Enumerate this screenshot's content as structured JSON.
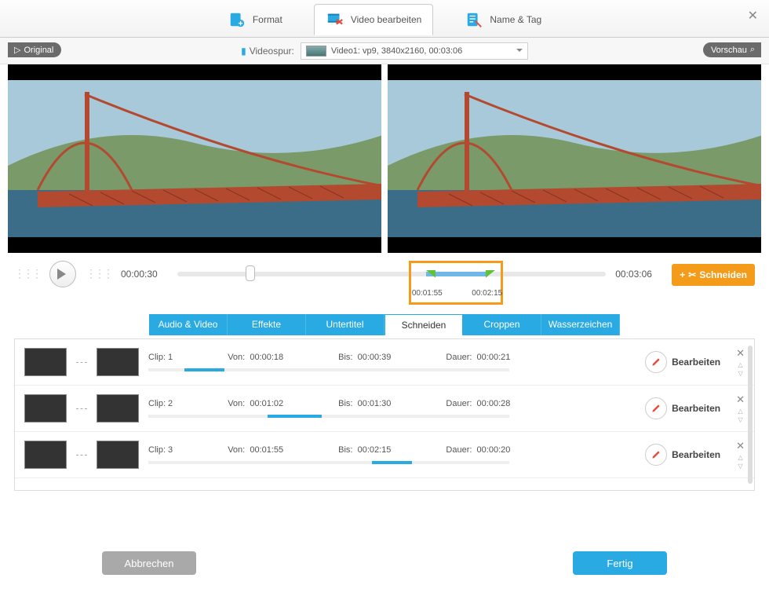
{
  "header": {
    "tabs": [
      {
        "label": "Format",
        "icon": "format"
      },
      {
        "label": "Video bearbeiten",
        "icon": "edit-video",
        "active": true
      },
      {
        "label": "Name & Tag",
        "icon": "tag"
      }
    ]
  },
  "trackbar": {
    "label": "Videospur:",
    "selected": "Video1: vp9, 3840x2160, 00:03:06",
    "original_label": "Original",
    "preview_label": "Vorschau"
  },
  "timeline": {
    "current": "00:00:30",
    "duration": "00:03:06",
    "sel_start": "00:01:55",
    "sel_end": "00:02:15",
    "playhead_pct": 16,
    "sel_start_pct": 58,
    "sel_end_pct": 72,
    "cut_label": "Schneiden"
  },
  "subtabs": [
    "Audio & Video",
    "Effekte",
    "Untertitel",
    "Schneiden",
    "Croppen",
    "Wasserzeichen"
  ],
  "subtab_active": 3,
  "clip_labels": {
    "clip": "Clip:",
    "von": "Von:",
    "bis": "Bis:",
    "dauer": "Dauer:",
    "edit": "Bearbeiten"
  },
  "clips": [
    {
      "n": "1",
      "von": "00:00:18",
      "bis": "00:00:39",
      "dauer": "00:00:21",
      "seg_l": 10,
      "seg_w": 11
    },
    {
      "n": "2",
      "von": "00:01:02",
      "bis": "00:01:30",
      "dauer": "00:00:28",
      "seg_l": 33,
      "seg_w": 15
    },
    {
      "n": "3",
      "von": "00:01:55",
      "bis": "00:02:15",
      "dauer": "00:00:20",
      "seg_l": 62,
      "seg_w": 11
    }
  ],
  "footer": {
    "cancel": "Abbrechen",
    "done": "Fertig"
  }
}
